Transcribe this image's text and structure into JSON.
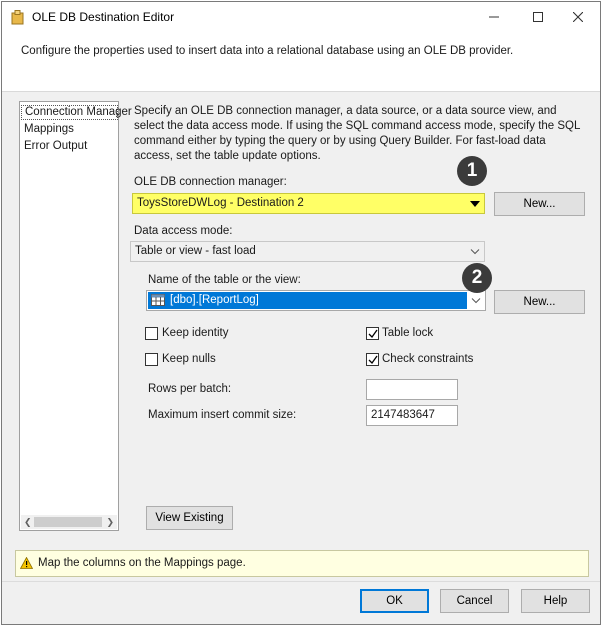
{
  "window": {
    "title": "OLE DB Destination Editor",
    "icons": {
      "app": "package-icon",
      "minimize": "minimize-icon",
      "maximize": "maximize-icon",
      "close": "close-icon"
    }
  },
  "header": {
    "description": "Configure the properties used to insert data into a relational database using an OLE DB provider."
  },
  "nav": {
    "items": [
      {
        "label": "Connection Manager",
        "selected": true
      },
      {
        "label": "Mappings",
        "selected": false
      },
      {
        "label": "Error Output",
        "selected": false
      }
    ]
  },
  "main": {
    "instructions": "Specify an OLE DB connection manager, a data source, or a data source view, and select the data access mode. If using the SQL command access mode, specify the SQL command either by typing the query or by using Query Builder. For fast-load data access, set the table update options.",
    "connection_manager": {
      "label": "OLE DB connection manager:",
      "value": "ToysStoreDWLog - Destination 2",
      "highlight_color": "#ffff66",
      "new_button": "New...",
      "badge": "1"
    },
    "data_access_mode": {
      "label": "Data access mode:",
      "value": "Table or view - fast load"
    },
    "table_name": {
      "label": "Name of the table or the view:",
      "value": "[dbo].[ReportLog]",
      "selection_color": "#0078d7",
      "new_button": "New...",
      "badge": "2"
    },
    "options": {
      "keep_identity": {
        "label": "Keep identity",
        "checked": false
      },
      "table_lock": {
        "label": "Table lock",
        "checked": true
      },
      "keep_nulls": {
        "label": "Keep nulls",
        "checked": false
      },
      "check_constraints": {
        "label": "Check constraints",
        "checked": true
      }
    },
    "rows_per_batch": {
      "label": "Rows per batch:",
      "value": ""
    },
    "max_insert_commit_size": {
      "label": "Maximum insert commit size:",
      "value": "2147483647"
    },
    "view_existing_button": "View Existing"
  },
  "status": {
    "warning_icon": "warning-icon",
    "message": "Map the columns on the Mappings page."
  },
  "footer": {
    "ok": "OK",
    "cancel": "Cancel",
    "help": "Help"
  }
}
